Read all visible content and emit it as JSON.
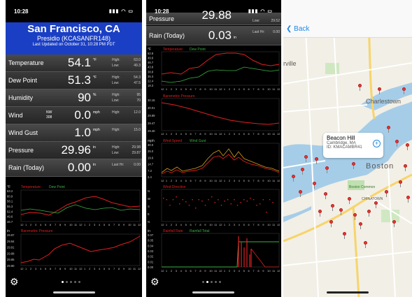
{
  "screen1": {
    "status_time": "10:28",
    "city": "San Francisco, CA",
    "station": "Presidio (KCASANFR148)",
    "updated": "Last Updated on October 31, 10:28 PM PDT",
    "rows": [
      {
        "label": "Temperature",
        "value": "54.1",
        "unit": "°F",
        "hl1": "High:",
        "hl2": "Low:",
        "v1": "63.0",
        "v2": "49.3"
      },
      {
        "label": "Dew Point",
        "value": "51.3",
        "unit": "°F",
        "hl1": "High:",
        "hl2": "Low:",
        "v1": "54.3",
        "v2": "47.5"
      },
      {
        "label": "Humidity",
        "value": "90",
        "unit": "%",
        "hl1": "High:",
        "hl2": "Low:",
        "v1": "95",
        "v2": "70"
      },
      {
        "label": "Wind",
        "sub1": "NW",
        "sub2": "308",
        "value": "0.0",
        "unit": "mph",
        "hl1": "High:",
        "hl2": "",
        "v1": "12.0",
        "v2": ""
      },
      {
        "label": "Wind Gust",
        "value": "1.0",
        "unit": "mph",
        "hl1": "High:",
        "hl2": "",
        "v1": "15.0",
        "v2": ""
      },
      {
        "label": "Pressure",
        "value": "29.96",
        "unit": "in",
        "hl1": "High:",
        "hl2": "Low:",
        "v1": "29.98",
        "v2": "29.87"
      },
      {
        "label": "Rain (Today)",
        "value": "0.00",
        "unit": "in",
        "hl1": "Last Hr:",
        "hl2": "",
        "v1": "0.00",
        "v2": ""
      }
    ],
    "chart1": {
      "unit": "°F",
      "legend": [
        "Temperature",
        "Dew Point"
      ],
      "yticks": [
        "63.2",
        "60.9",
        "58.1",
        "55.3",
        "52.4",
        "49.6",
        "46.7"
      ]
    },
    "chart2": {
      "unit": "in",
      "legend": [
        "Barometric Pressure"
      ],
      "yticks": [
        "29.97",
        "29.94",
        "29.91",
        "29.88",
        "29.85",
        "29.80"
      ]
    }
  },
  "screen2": {
    "status_time": "10:28",
    "top_row": {
      "label": "Pressure",
      "value": "29.88",
      "hl": "Low:",
      "v": "29.52"
    },
    "rain_row": {
      "label": "Rain (Today)",
      "value": "0.03",
      "unit": "in",
      "hl": "Last Hr:",
      "v": "0.00"
    },
    "chart_temp": {
      "unit": "°F",
      "legend": [
        "Temperature",
        "Dew Point"
      ],
      "yticks": [
        "52.8",
        "49.6",
        "46.7",
        "43.8",
        "38.8",
        "35.3",
        "22.4",
        "18.3"
      ]
    },
    "chart_pressure": {
      "unit": "in",
      "legend": [
        "Barometric Pressure"
      ],
      "yticks": [
        "30.15",
        "30.01",
        "29.89",
        "29.47",
        "29.40"
      ]
    },
    "chart_wind": {
      "unit": "mph",
      "legend": [
        "Wind Speed",
        "Wind Gust"
      ],
      "yticks": [
        "30.0",
        "25.0",
        "19.6",
        "14.7",
        "7.3",
        "2.4"
      ]
    },
    "chart_dir": {
      "legend": [
        "Wind Direction"
      ],
      "yticks": [
        "N",
        "W",
        "S",
        "E",
        "N"
      ]
    },
    "chart_rain": {
      "unit": "in",
      "legend": [
        "Rainfall Rate",
        "Rainfall Total"
      ],
      "yticks": [
        "0.07",
        "0.05",
        "0.04",
        "0.03",
        "0.02",
        "0.01",
        "0.00"
      ]
    }
  },
  "xticks": [
    "12",
    "1",
    "2",
    "3",
    "4",
    "5",
    "6",
    "7",
    "8",
    "9",
    "10",
    "11",
    "12",
    "1",
    "2",
    "3",
    "4",
    "5",
    "6",
    "7",
    "8",
    "9",
    "10",
    "11",
    "12"
  ],
  "screen3": {
    "back_label": "Back",
    "callout_title": "Beacon Hill",
    "callout_sub": "Cambridge, MA",
    "callout_id": "ID: KMACAMBR41",
    "labels": [
      "Charlestown",
      "Boston",
      "rville",
      "Boston Common",
      "CHINATOWN"
    ]
  },
  "colors": {
    "header": "#1a3fc4",
    "red": "#e02020",
    "green": "#3cb043",
    "blue": "#1e88e5"
  }
}
